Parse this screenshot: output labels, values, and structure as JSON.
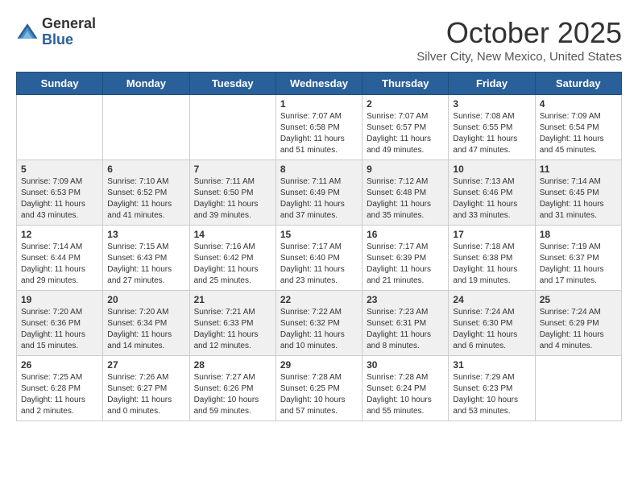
{
  "header": {
    "logo_general": "General",
    "logo_blue": "Blue",
    "month": "October 2025",
    "location": "Silver City, New Mexico, United States"
  },
  "days_of_week": [
    "Sunday",
    "Monday",
    "Tuesday",
    "Wednesday",
    "Thursday",
    "Friday",
    "Saturday"
  ],
  "weeks": [
    [
      {
        "day": "",
        "info": ""
      },
      {
        "day": "",
        "info": ""
      },
      {
        "day": "",
        "info": ""
      },
      {
        "day": "1",
        "info": "Sunrise: 7:07 AM\nSunset: 6:58 PM\nDaylight: 11 hours and 51 minutes."
      },
      {
        "day": "2",
        "info": "Sunrise: 7:07 AM\nSunset: 6:57 PM\nDaylight: 11 hours and 49 minutes."
      },
      {
        "day": "3",
        "info": "Sunrise: 7:08 AM\nSunset: 6:55 PM\nDaylight: 11 hours and 47 minutes."
      },
      {
        "day": "4",
        "info": "Sunrise: 7:09 AM\nSunset: 6:54 PM\nDaylight: 11 hours and 45 minutes."
      }
    ],
    [
      {
        "day": "5",
        "info": "Sunrise: 7:09 AM\nSunset: 6:53 PM\nDaylight: 11 hours and 43 minutes."
      },
      {
        "day": "6",
        "info": "Sunrise: 7:10 AM\nSunset: 6:52 PM\nDaylight: 11 hours and 41 minutes."
      },
      {
        "day": "7",
        "info": "Sunrise: 7:11 AM\nSunset: 6:50 PM\nDaylight: 11 hours and 39 minutes."
      },
      {
        "day": "8",
        "info": "Sunrise: 7:11 AM\nSunset: 6:49 PM\nDaylight: 11 hours and 37 minutes."
      },
      {
        "day": "9",
        "info": "Sunrise: 7:12 AM\nSunset: 6:48 PM\nDaylight: 11 hours and 35 minutes."
      },
      {
        "day": "10",
        "info": "Sunrise: 7:13 AM\nSunset: 6:46 PM\nDaylight: 11 hours and 33 minutes."
      },
      {
        "day": "11",
        "info": "Sunrise: 7:14 AM\nSunset: 6:45 PM\nDaylight: 11 hours and 31 minutes."
      }
    ],
    [
      {
        "day": "12",
        "info": "Sunrise: 7:14 AM\nSunset: 6:44 PM\nDaylight: 11 hours and 29 minutes."
      },
      {
        "day": "13",
        "info": "Sunrise: 7:15 AM\nSunset: 6:43 PM\nDaylight: 11 hours and 27 minutes."
      },
      {
        "day": "14",
        "info": "Sunrise: 7:16 AM\nSunset: 6:42 PM\nDaylight: 11 hours and 25 minutes."
      },
      {
        "day": "15",
        "info": "Sunrise: 7:17 AM\nSunset: 6:40 PM\nDaylight: 11 hours and 23 minutes."
      },
      {
        "day": "16",
        "info": "Sunrise: 7:17 AM\nSunset: 6:39 PM\nDaylight: 11 hours and 21 minutes."
      },
      {
        "day": "17",
        "info": "Sunrise: 7:18 AM\nSunset: 6:38 PM\nDaylight: 11 hours and 19 minutes."
      },
      {
        "day": "18",
        "info": "Sunrise: 7:19 AM\nSunset: 6:37 PM\nDaylight: 11 hours and 17 minutes."
      }
    ],
    [
      {
        "day": "19",
        "info": "Sunrise: 7:20 AM\nSunset: 6:36 PM\nDaylight: 11 hours and 15 minutes."
      },
      {
        "day": "20",
        "info": "Sunrise: 7:20 AM\nSunset: 6:34 PM\nDaylight: 11 hours and 14 minutes."
      },
      {
        "day": "21",
        "info": "Sunrise: 7:21 AM\nSunset: 6:33 PM\nDaylight: 11 hours and 12 minutes."
      },
      {
        "day": "22",
        "info": "Sunrise: 7:22 AM\nSunset: 6:32 PM\nDaylight: 11 hours and 10 minutes."
      },
      {
        "day": "23",
        "info": "Sunrise: 7:23 AM\nSunset: 6:31 PM\nDaylight: 11 hours and 8 minutes."
      },
      {
        "day": "24",
        "info": "Sunrise: 7:24 AM\nSunset: 6:30 PM\nDaylight: 11 hours and 6 minutes."
      },
      {
        "day": "25",
        "info": "Sunrise: 7:24 AM\nSunset: 6:29 PM\nDaylight: 11 hours and 4 minutes."
      }
    ],
    [
      {
        "day": "26",
        "info": "Sunrise: 7:25 AM\nSunset: 6:28 PM\nDaylight: 11 hours and 2 minutes."
      },
      {
        "day": "27",
        "info": "Sunrise: 7:26 AM\nSunset: 6:27 PM\nDaylight: 11 hours and 0 minutes."
      },
      {
        "day": "28",
        "info": "Sunrise: 7:27 AM\nSunset: 6:26 PM\nDaylight: 10 hours and 59 minutes."
      },
      {
        "day": "29",
        "info": "Sunrise: 7:28 AM\nSunset: 6:25 PM\nDaylight: 10 hours and 57 minutes."
      },
      {
        "day": "30",
        "info": "Sunrise: 7:28 AM\nSunset: 6:24 PM\nDaylight: 10 hours and 55 minutes."
      },
      {
        "day": "31",
        "info": "Sunrise: 7:29 AM\nSunset: 6:23 PM\nDaylight: 10 hours and 53 minutes."
      },
      {
        "day": "",
        "info": ""
      }
    ]
  ]
}
